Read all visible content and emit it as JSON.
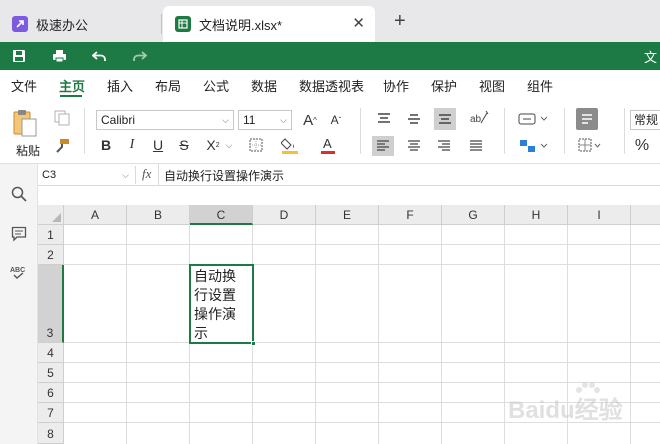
{
  "tabs": [
    {
      "label": "极速办公",
      "icon": "app-launcher-icon"
    },
    {
      "label": "文档说明.xlsx*",
      "icon": "spreadsheet-icon"
    }
  ],
  "quick_access": {
    "icons": [
      "save-icon",
      "print-icon",
      "undo-icon",
      "redo-icon"
    ],
    "right_text": "文"
  },
  "menu": [
    "文件",
    "主页",
    "插入",
    "布局",
    "公式",
    "数据",
    "数据透视表",
    "协作",
    "保护",
    "视图",
    "组件"
  ],
  "active_menu": "主页",
  "ribbon": {
    "paste_label": "粘贴",
    "font_name": "Calibri",
    "font_size": "11",
    "bold": "B",
    "italic": "I",
    "underline": "U",
    "strike": "S",
    "subscript": "X",
    "grow_font": "A",
    "shrink_font": "A",
    "font_color": "A",
    "number_format": "常规",
    "percent": "%"
  },
  "formula_bar": {
    "cell_ref": "C3",
    "fx": "fx",
    "content": "自动换行设置操作演示"
  },
  "grid": {
    "columns": [
      "A",
      "B",
      "C",
      "D",
      "E",
      "F",
      "G",
      "H",
      "I"
    ],
    "selected_column": "C",
    "rows": [
      "1",
      "2",
      "3",
      "4",
      "5",
      "6",
      "7",
      "8"
    ],
    "selected_row": "3",
    "active_cell_text": "自动换行设置操作演示"
  },
  "watermark": "Baidu经验",
  "colors": {
    "brand_green": "#1e7a45",
    "tab_bar": "#e8e8ea",
    "header_gray": "#ececec"
  }
}
